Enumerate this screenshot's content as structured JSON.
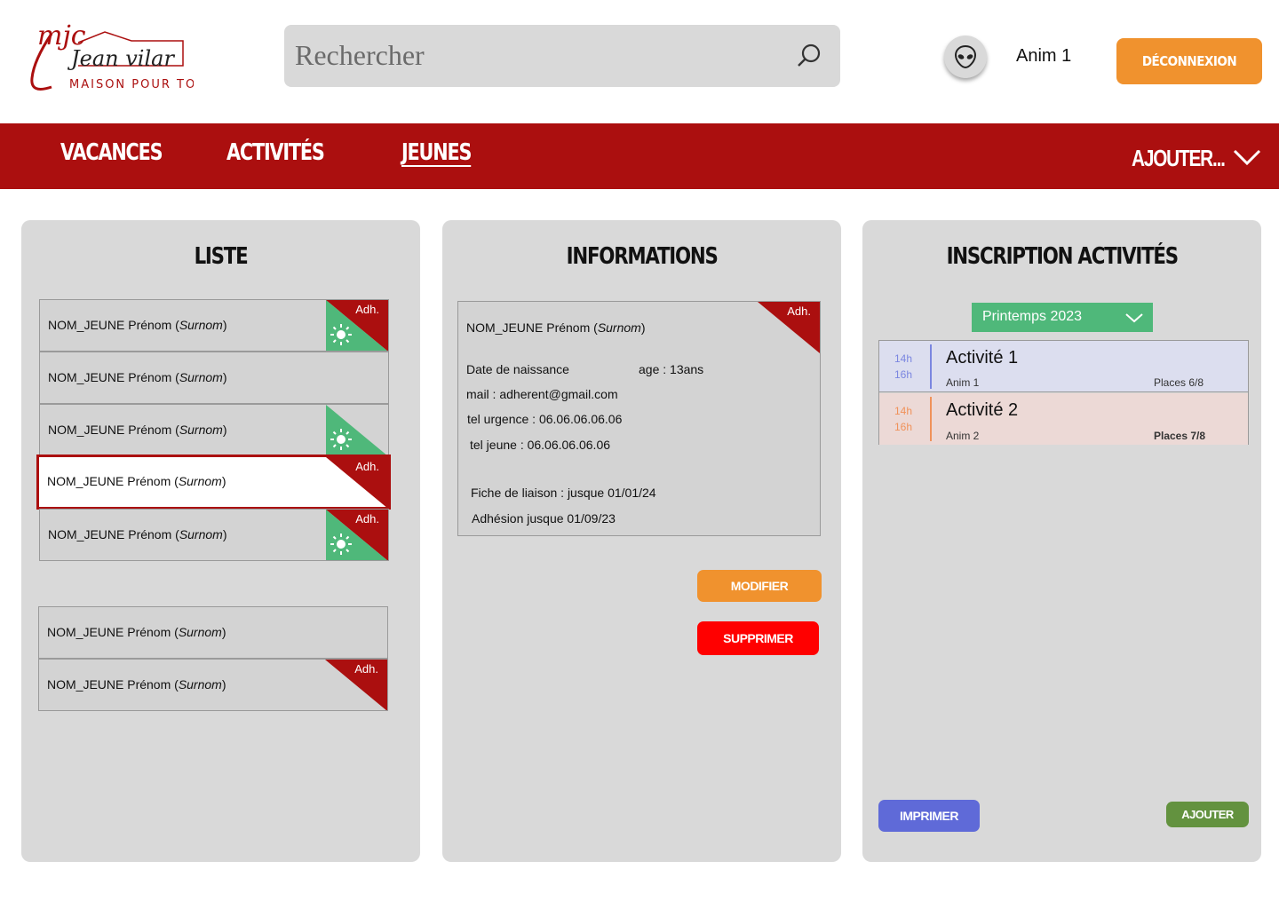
{
  "header": {
    "logo": {
      "line1": "mjc",
      "line2": "Jean vilar",
      "line3": "MAISON POUR TOUS"
    },
    "search": {
      "placeholder": "Rechercher"
    },
    "user": {
      "name": "Anim 1"
    },
    "logout_label": "DÉCONNEXION"
  },
  "nav": {
    "items": [
      {
        "label": "VACANCES",
        "active": false
      },
      {
        "label": "ACTIVITÉS",
        "active": false
      },
      {
        "label": "JEUNES",
        "active": true
      }
    ],
    "add_label": "AJOUTER..."
  },
  "list_panel": {
    "title": "LISTE",
    "rows": [
      {
        "name": "NOM_JEUNE Prénom (",
        "surnom": "Surnom",
        "close": ")",
        "adh": "Adh.",
        "badge": "green"
      },
      {
        "name": "NOM_JEUNE Prénom (",
        "surnom": "Surnom",
        "close": ")",
        "adh": "",
        "badge": "none"
      },
      {
        "name": "NOM_JEUNE Prénom (",
        "surnom": "Surnom",
        "close": ")",
        "adh": "",
        "badge": "green-noadh"
      },
      {
        "name": "NOM_JEUNE Prénom (",
        "surnom": "Surnom",
        "close": ")",
        "adh": "Adh.",
        "badge": "red",
        "selected": true
      },
      {
        "name": "NOM_JEUNE Prénom (",
        "surnom": "Surnom",
        "close": ")",
        "adh": "Adh.",
        "badge": "green"
      },
      {
        "name": "NOM_JEUNE Prénom (",
        "surnom": "Surnom",
        "close": ")",
        "adh": "",
        "badge": "none"
      },
      {
        "name": "NOM_JEUNE Prénom (",
        "surnom": "Surnom",
        "close": ")",
        "adh": "Adh.",
        "badge": "red"
      }
    ]
  },
  "info_panel": {
    "title": "INFORMATIONS",
    "name": "NOM_JEUNE Prénom (",
    "surnom": "Surnom",
    "close": ")",
    "adh": "Adh.",
    "birth_label": "Date de naissance",
    "age": "age : 13ans",
    "mail": "mail : adherent@gmail.com",
    "tel_urgence": "tel urgence : 06.06.06.06.06",
    "tel_jeune": "tel jeune : 06.06.06.06.06",
    "fiche": "Fiche de liaison : jusque 01/01/24",
    "adhesion": "Adhésion jusque 01/09/23",
    "modify_label": "MODIFIER",
    "delete_label": "SUPPRIMER"
  },
  "activities_panel": {
    "title": "INSCRIPTION ACTIVITÉS",
    "season": "Printemps 2023",
    "activities": [
      {
        "start": "14h",
        "end": "16h",
        "name": "Activité 1",
        "anim": "Anim 1",
        "places": "Places 6/8",
        "color": "#7b86e0",
        "bg": "#dcdeef"
      },
      {
        "start": "14h",
        "end": "16h",
        "name": "Activité 2",
        "anim": "Anim 2",
        "places": "Places 7/8",
        "color": "#f0925a",
        "bg": "#ecd9d6"
      }
    ],
    "print_label": "IMPRIMER",
    "add_label": "AJOUTER"
  },
  "colors": {
    "brand_red": "#ab0f0f",
    "orange": "#f0922e",
    "green": "#4fb87a",
    "blue": "#5f6ad8"
  }
}
